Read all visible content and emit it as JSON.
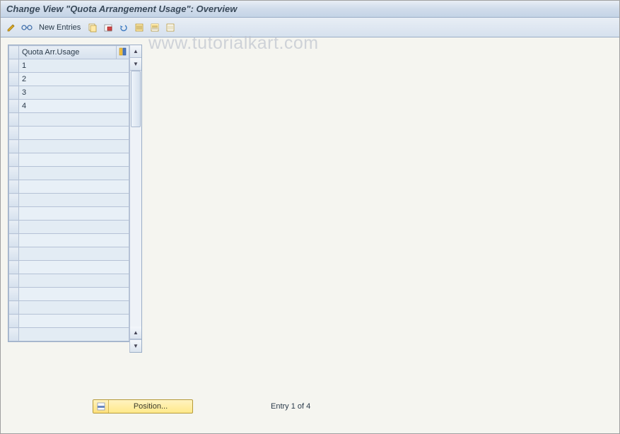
{
  "title": "Change View \"Quota Arrangement Usage\": Overview",
  "toolbar": {
    "new_entries_label": "New Entries",
    "icons": {
      "change": "change-icon",
      "other": "glasses-icon",
      "copy": "copy-icon",
      "delete": "delete-icon",
      "undo": "undo-icon",
      "select_all": "select-all-icon",
      "select_block": "select-block-icon",
      "deselect": "deselect-icon"
    }
  },
  "table": {
    "header": "Quota Arr.Usage",
    "rows": [
      "1",
      "2",
      "3",
      "4"
    ],
    "total_visible_rows": 21
  },
  "footer": {
    "position_label": "Position...",
    "entry_text": "Entry 1 of 4"
  },
  "watermark": "www.tutorialkart.com"
}
